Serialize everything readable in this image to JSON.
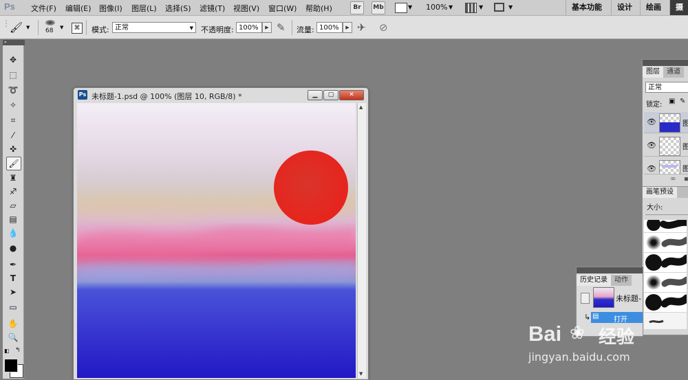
{
  "menubar": {
    "app_logo": "Ps",
    "items": [
      "文件(F)",
      "编辑(E)",
      "图像(I)",
      "图层(L)",
      "选择(S)",
      "滤镜(T)",
      "视图(V)",
      "窗口(W)",
      "帮助(H)"
    ],
    "bridge_label": "Br",
    "minibridge_label": "Mb",
    "zoom": "100%",
    "workspaces": [
      "基本功能",
      "设计",
      "绘画",
      "摄"
    ]
  },
  "options": {
    "brush_size": "68",
    "mode_label": "模式:",
    "mode_value": "正常",
    "opacity_label": "不透明度:",
    "opacity_value": "100%",
    "flow_label": "流量:",
    "flow_value": "100%"
  },
  "document": {
    "icon_label": "Ps",
    "title": "未标题-1.psd @ 100% (图层 10, RGB/8) *",
    "colors": {
      "sun": "#e8231c",
      "sea": "#2020c8",
      "sky_top": "#f2eaf4"
    }
  },
  "layers_panel": {
    "tabs": [
      "图层",
      "通道"
    ],
    "blend_mode": "正常",
    "lock_label": "锁定:",
    "layer_name_prefix": "图"
  },
  "brush_panel": {
    "tabs": [
      "画笔预设"
    ],
    "size_label": "大小:"
  },
  "history_panel": {
    "tabs": [
      "历史记录",
      "动作"
    ],
    "snapshot_name": "未标题-",
    "open_step": "打开"
  },
  "watermark": {
    "brand": "Bai",
    "brand_cn": "经验",
    "url": "jingyan.baidu.com"
  }
}
